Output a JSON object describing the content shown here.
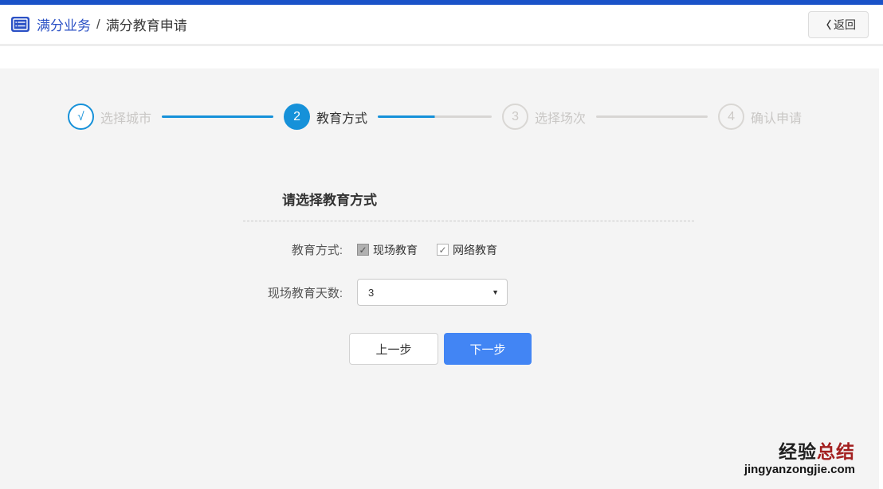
{
  "header": {
    "breadcrumb": {
      "section": "满分业务",
      "separator": "/",
      "page": "满分教育申请"
    },
    "back_button": {
      "chevron": "〈",
      "label": "返回"
    }
  },
  "stepper": {
    "steps": [
      {
        "number": "√",
        "label": "选择城市",
        "state": "done"
      },
      {
        "number": "2",
        "label": "教育方式",
        "state": "active"
      },
      {
        "number": "3",
        "label": "选择场次",
        "state": "pending"
      },
      {
        "number": "4",
        "label": "确认申请",
        "state": "pending"
      }
    ]
  },
  "form": {
    "title": "请选择教育方式",
    "education_method": {
      "label": "教育方式:",
      "options": [
        {
          "label": "现场教育",
          "checked": true,
          "disabled": true
        },
        {
          "label": "网络教育",
          "checked": true,
          "disabled": false
        }
      ]
    },
    "onsite_days": {
      "label": "现场教育天数:",
      "value": "3"
    }
  },
  "actions": {
    "prev_label": "上一步",
    "next_label": "下一步"
  },
  "icons": {
    "check": "✓",
    "dropdown_arrow": "▼"
  },
  "watermark": {
    "line1_part1": "经验",
    "line1_part2": "总结",
    "line2": "jingyanzongjie.com"
  },
  "colors": {
    "top_bar": "#1a52c8",
    "breadcrumb_blue": "#2b51c5",
    "step_active_blue": "#1691d9",
    "next_button_blue": "#4285f4",
    "panel_gray": "#f4f4f4",
    "watermark_red": "#a32020"
  }
}
